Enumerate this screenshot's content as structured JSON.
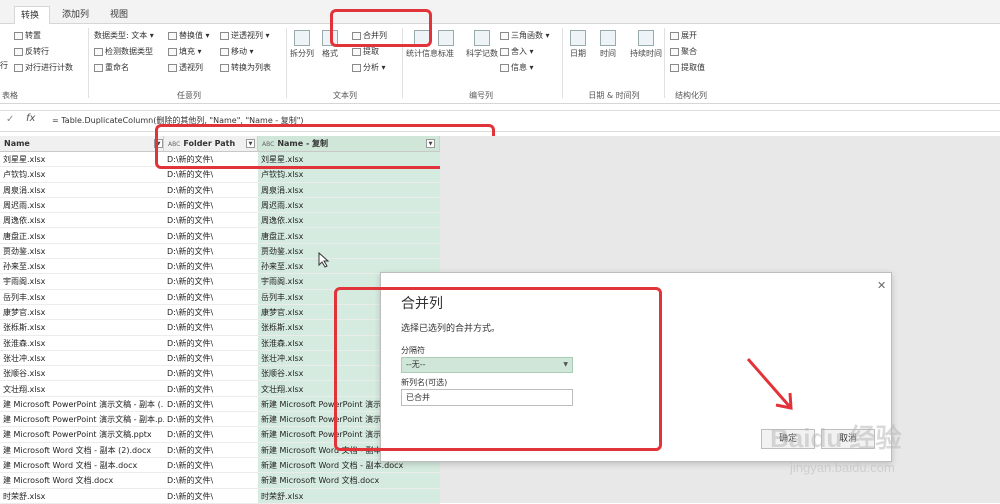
{
  "tabs": [
    "转换",
    "添加列",
    "视图"
  ],
  "ribbon": {
    "table_group": {
      "items": [
        "转置",
        "反转行",
        "对行进行计数"
      ],
      "label": "表格",
      "partial_left": "行"
    },
    "any_column": {
      "items": [
        "数据类型: 文本 ▾",
        "检测数据类型",
        "重命名",
        "替换值 ▾",
        "填充 ▾",
        "透视列",
        "逆透视列 ▾",
        "移动 ▾",
        "转换为列表"
      ],
      "label": "任意列"
    },
    "text_column": {
      "big": [
        "拆分列",
        "格式",
        "提取",
        "分析"
      ],
      "small": [
        "合并列",
        "提取",
        "分析 ▾"
      ],
      "label": "文本列"
    },
    "number_column": {
      "big": [
        "统计信息",
        "标准",
        "科学记数"
      ],
      "small": [
        "三角函数 ▾",
        "舍入 ▾",
        "信息 ▾"
      ],
      "label": "编号列"
    },
    "datetime": {
      "big": [
        "日期",
        "时间",
        "持续时间"
      ],
      "label": "日期 & 时间列"
    },
    "structured": {
      "items": [
        "展开",
        "聚合",
        "提取值"
      ],
      "label": "结构化列"
    }
  },
  "formula": {
    "cancel_icon": "✓",
    "fx": "fx",
    "text": "= Table.DuplicateColumn(删除的其他列, \"Name\", \"Name - 复制\")"
  },
  "columns": [
    {
      "name": "Name",
      "type": "",
      "partial": true
    },
    {
      "name": "Folder Path",
      "type": "ABC"
    },
    {
      "name": "Name - 复制",
      "type": "ABC"
    }
  ],
  "rows": [
    [
      "刘星星.xlsx",
      "D:\\新的文件\\",
      "刘星星.xlsx"
    ],
    [
      "卢钦钧.xlsx",
      "D:\\新的文件\\",
      "卢钦钧.xlsx"
    ],
    [
      "周泉涓.xlsx",
      "D:\\新的文件\\",
      "周泉涓.xlsx"
    ],
    [
      "周迟雨.xlsx",
      "D:\\新的文件\\",
      "周迟雨.xlsx"
    ],
    [
      "周逸依.xlsx",
      "D:\\新的文件\\",
      "周逸依.xlsx"
    ],
    [
      "唐盘正.xlsx",
      "D:\\新的文件\\",
      "唐盘正.xlsx"
    ],
    [
      "贾劲鉴.xlsx",
      "D:\\新的文件\\",
      "贾劲鉴.xlsx"
    ],
    [
      "孙来至.xlsx",
      "D:\\新的文件\\",
      "孙来至.xlsx"
    ],
    [
      "宇雨阁.xlsx",
      "D:\\新的文件\\",
      "宇雨阁.xlsx"
    ],
    [
      "岳列丰.xlsx",
      "D:\\新的文件\\",
      "岳列丰.xlsx"
    ],
    [
      "康梦官.xlsx",
      "D:\\新的文件\\",
      "康梦官.xlsx"
    ],
    [
      "张栎斯.xlsx",
      "D:\\新的文件\\",
      "张栎斯.xlsx"
    ],
    [
      "张淮森.xlsx",
      "D:\\新的文件\\",
      "张淮森.xlsx"
    ],
    [
      "张壮冲.xlsx",
      "D:\\新的文件\\",
      "张壮冲.xlsx"
    ],
    [
      "张顺谷.xlsx",
      "D:\\新的文件\\",
      "张顺谷.xlsx"
    ],
    [
      "文壮翔.xlsx",
      "D:\\新的文件\\",
      "文壮翔.xlsx"
    ],
    [
      "建 Microsoft PowerPoint 演示文稿 - 副本 (...",
      "D:\\新的文件\\",
      "新建 Microsoft PowerPoint 演示"
    ],
    [
      "建 Microsoft PowerPoint 演示文稿 - 副本.p...",
      "D:\\新的文件\\",
      "新建 Microsoft PowerPoint 演示"
    ],
    [
      "建 Microsoft PowerPoint 演示文稿.pptx",
      "D:\\新的文件\\",
      "新建 Microsoft PowerPoint 演示"
    ],
    [
      "建 Microsoft Word 文档 - 副本 (2).docx",
      "D:\\新的文件\\",
      "新建 Microsoft Word 文档 - 副本"
    ],
    [
      "建 Microsoft Word 文档 - 副本.docx",
      "D:\\新的文件\\",
      "新建 Microsoft Word 文档 - 副本.docx"
    ],
    [
      "建 Microsoft Word 文档.docx",
      "D:\\新的文件\\",
      "新建 Microsoft Word 文档.docx"
    ],
    [
      "时荣舒.xlsx",
      "D:\\新的文件\\",
      "时荣舒.xlsx"
    ]
  ],
  "dialog": {
    "title": "合并列",
    "close": "✕",
    "description": "选择已选列的合并方式。",
    "separator_label": "分隔符",
    "separator_value": "--无--",
    "newcol_label": "新列名(可选)",
    "newcol_value": "已合并",
    "ok_label": "确定",
    "cancel_label": "取消"
  },
  "watermark": {
    "brand": "Baidu 经验",
    "url": "jingyan.baidu.com"
  },
  "colors": {
    "accent": "#217346",
    "highlight": "#e0343a",
    "selected_col": "#d6ebdf"
  }
}
